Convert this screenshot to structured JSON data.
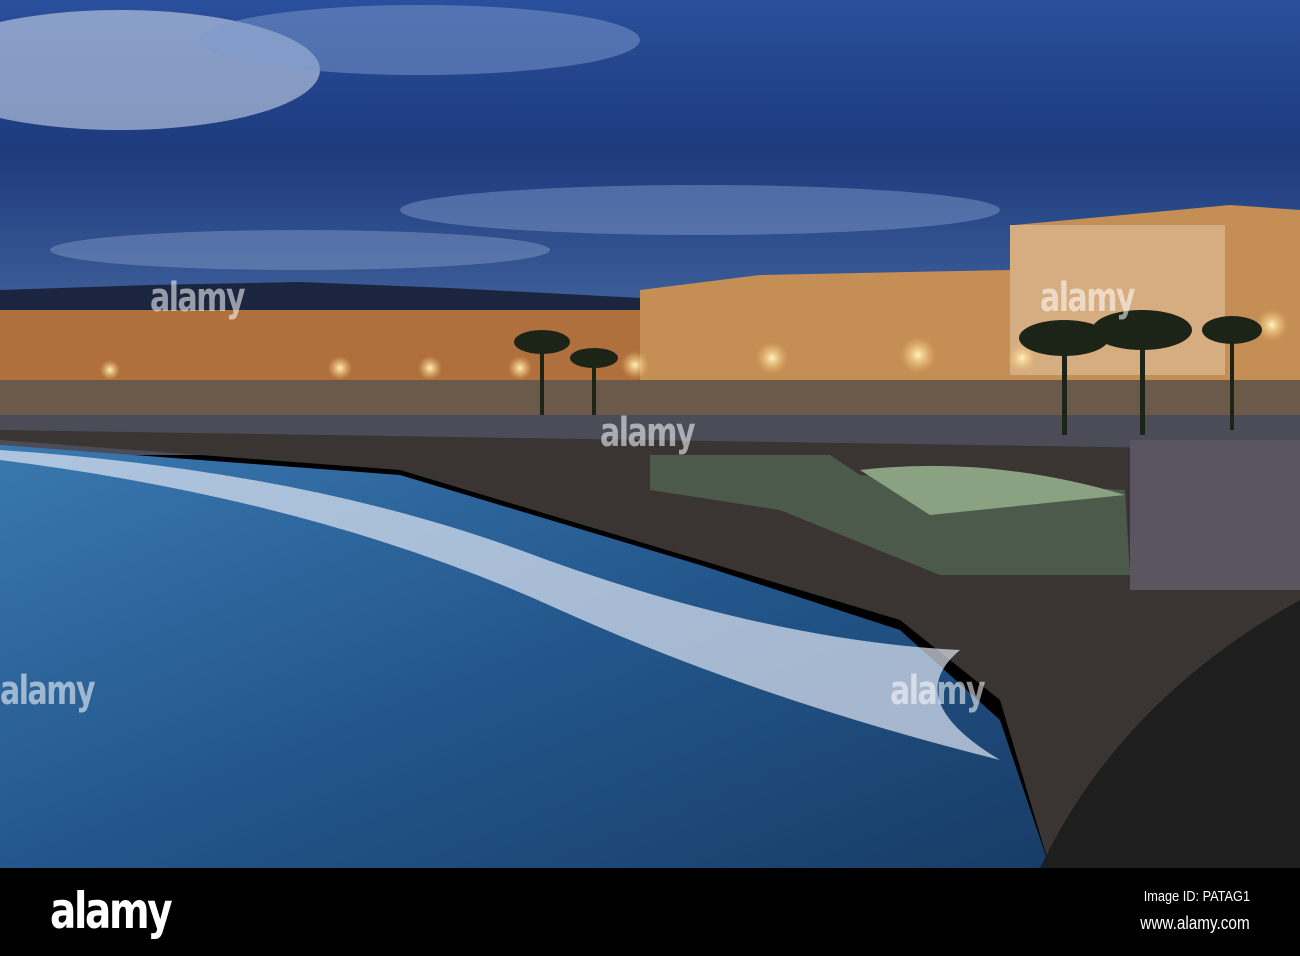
{
  "photo": {
    "subject": "Promenade des Anglais beach at dusk",
    "colors": {
      "sky": "#1f3f86",
      "sea": "#2a5a8e",
      "lights": "#f7c46a",
      "beach": "#3a3532"
    }
  },
  "watermark": {
    "text": "alamy"
  },
  "footer": {
    "logo": "alamy",
    "image_id": "Image ID: PATAG1",
    "website": "www.alamy.com"
  }
}
